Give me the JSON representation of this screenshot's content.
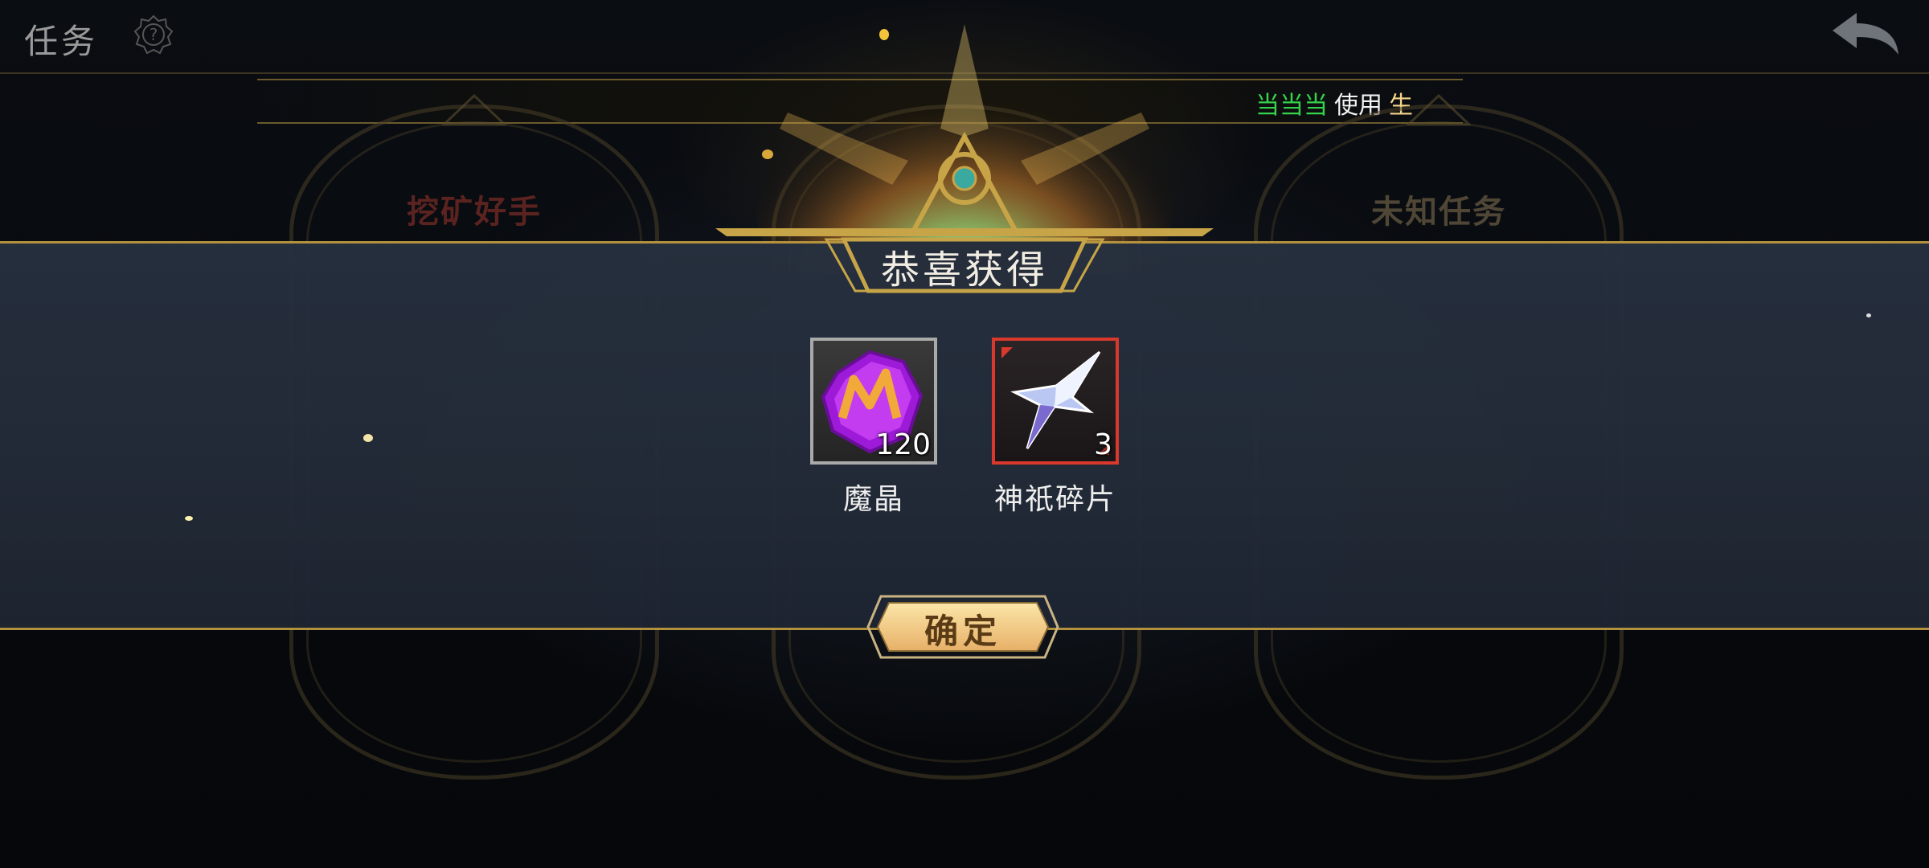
{
  "header": {
    "title": "任务",
    "help_icon": "help-gear-icon",
    "back_icon": "back-arrow-icon"
  },
  "notice": {
    "part1": "当当当",
    "part2": "使用",
    "part3": "生"
  },
  "cards": [
    {
      "title": "挖矿好手"
    },
    {
      "title": ""
    },
    {
      "title": "未知任务"
    }
  ],
  "modal": {
    "title": "恭喜获得",
    "items": [
      {
        "name": "魔晶",
        "count": "120",
        "icon": "magic-crystal-icon",
        "frame_color": "#a9a9a9"
      },
      {
        "name": "神祇碎片",
        "count": "3",
        "icon": "divine-shard-icon",
        "frame_color": "#d9382d"
      }
    ],
    "confirm_label": "确定"
  },
  "colors": {
    "accent_gold": "#b8953f",
    "band": "#26303f",
    "notice_green": "#35d24b"
  }
}
